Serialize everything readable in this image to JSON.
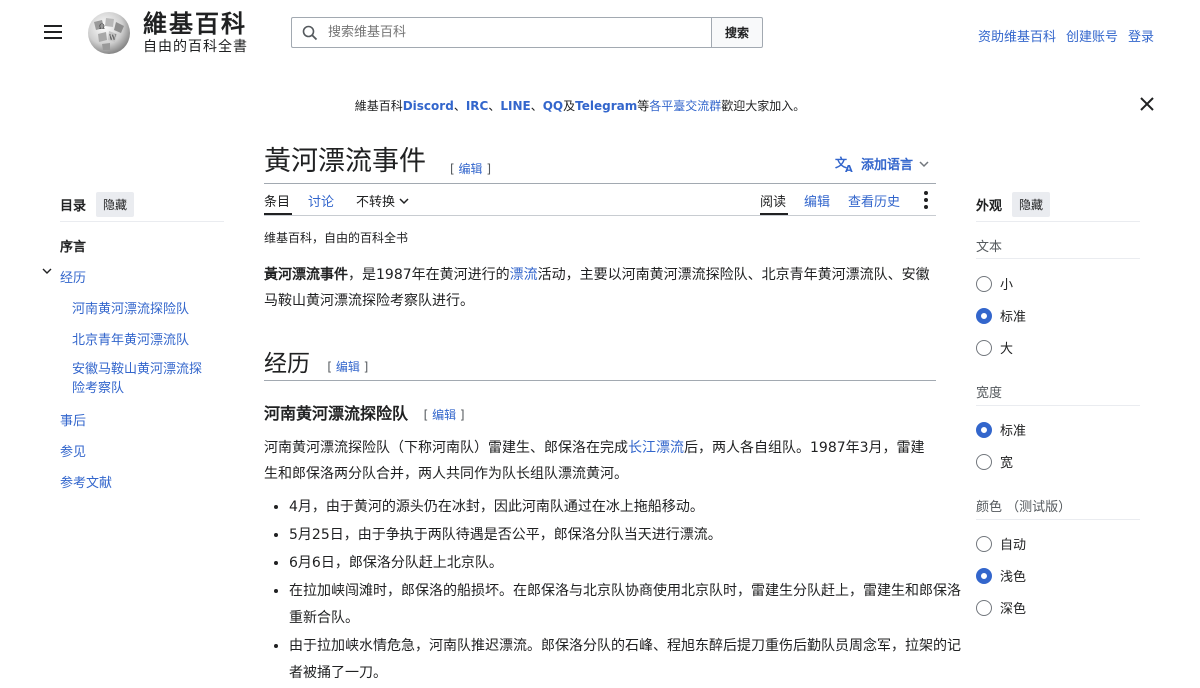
{
  "header": {
    "site_name": "維基百科",
    "site_tagline": "自由的百科全書",
    "search_placeholder": "搜索维基百科",
    "search_button": "搜索",
    "user_links": [
      "资助维基百科",
      "创建账号",
      "登录"
    ]
  },
  "notice": {
    "prefix": "維基百科",
    "items": [
      "Discord",
      "IRC",
      "LINE",
      "QQ"
    ],
    "sep": "、",
    "and": "及",
    "telegram": "Telegram",
    "etc": "等",
    "link": "各平臺交流群",
    "suffix": "歡迎大家加入。"
  },
  "article": {
    "title": "黃河漂流事件",
    "edit_label": "编辑",
    "language_button": "添加语言",
    "tabs_left": [
      "条目",
      "讨论",
      "不转换"
    ],
    "tabs_right": [
      "阅读",
      "编辑",
      "查看历史"
    ],
    "tagline": "维基百科，自由的百科全书",
    "lead": {
      "bold": "黃河漂流事件",
      "part1": "，是1987年在黄河进行的",
      "link": "漂流",
      "part2": "活动，主要以河南黄河漂流探险队、北京青年黄河漂流队、安徽马鞍山黄河漂流探险考察队进行。"
    },
    "h2": "经历",
    "h3": "河南黄河漂流探险队",
    "para": {
      "part1": "河南黄河漂流探险队（下称河南队）雷建生、郎保洛在完成",
      "link": "长江漂流",
      "part2": "后，两人各自组队。1987年3月，雷建生和郎保洛两分队合并，两人共同作为队长组队漂流黄河。"
    },
    "bullets": [
      "4月，由于黄河的源头仍在冰封，因此河南队通过在冰上拖船移动。",
      "5月25日，由于争执于两队待遇是否公平，郎保洛分队当天进行漂流。",
      "6月6日，郎保洛分队赶上北京队。",
      "在拉加峡闯滩时，郎保洛的船损坏。在郎保洛与北京队协商使用北京队时，雷建生分队赶上，雷建生和郎保洛重新合队。",
      "由于拉加峡水情危急，河南队推迟漂流。郎保洛分队的石峰、程旭东醉后提刀重伤后勤队员周念军，拉架的记者被捅了一刀。"
    ]
  },
  "toc": {
    "title": "目录",
    "hide": "隐藏",
    "items": {
      "intro": "序言",
      "history": "经历",
      "sub1": "河南黄河漂流探险队",
      "sub2": "北京青年黄河漂流队",
      "sub3a": "安徽马鞍山黄河漂流探",
      "sub3b": "险考察队",
      "aftermath": "事后",
      "seealso": "参见",
      "refs": "参考文献"
    }
  },
  "appearance": {
    "title": "外观",
    "hide": "隐藏",
    "text_label": "文本",
    "text_options": [
      "小",
      "标准",
      "大"
    ],
    "text_selected": "标准",
    "width_label": "宽度",
    "width_options": [
      "标准",
      "宽"
    ],
    "width_selected": "标准",
    "color_label": "颜色 （测试版）",
    "color_options": [
      "自动",
      "浅色",
      "深色"
    ],
    "color_selected": "浅色"
  },
  "colors": {
    "link": "#3366cc",
    "text": "#202122",
    "border": "#a2a9b1"
  }
}
